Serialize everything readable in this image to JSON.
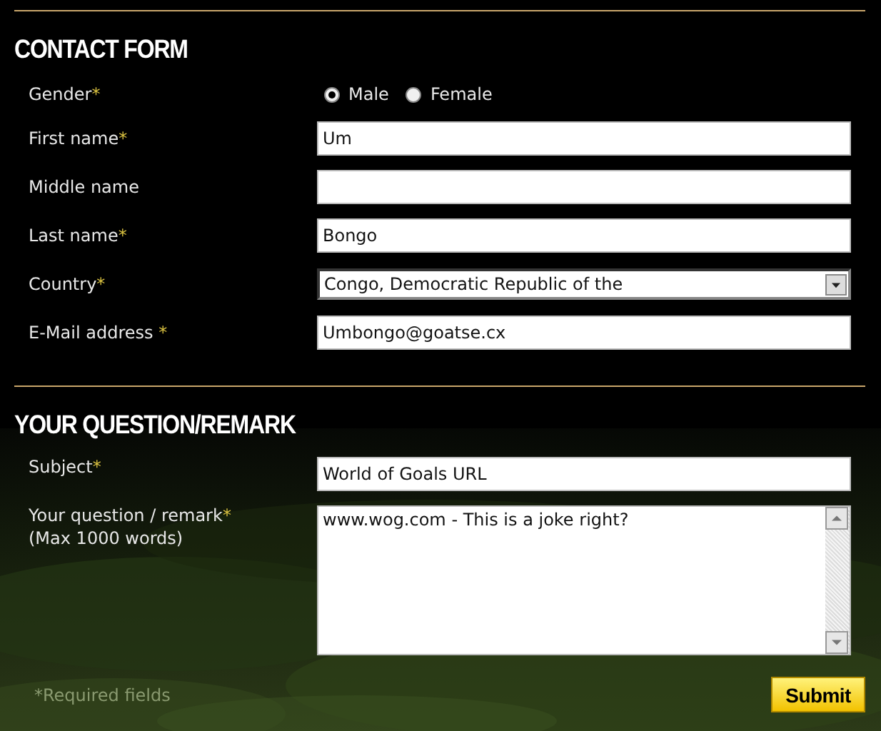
{
  "contact_form": {
    "heading": "CONTACT FORM",
    "gender": {
      "label": "Gender",
      "mark": "*",
      "options": [
        {
          "label": "Male",
          "selected": true
        },
        {
          "label": "Female",
          "selected": false
        }
      ]
    },
    "fields": [
      {
        "kind": "text",
        "label": "First name",
        "mark": "*",
        "value": "Um"
      },
      {
        "kind": "text",
        "label": "Middle name"
      },
      {
        "kind": "text",
        "label": "Last name",
        "mark": "*",
        "value": "Bongo"
      },
      {
        "kind": "select",
        "label": "Country",
        "mark": "*",
        "value": "Congo, Democratic Republic of the"
      },
      {
        "kind": "text",
        "label": "E-Mail address ",
        "mark": "*",
        "value": "Umbongo@goatse.cx"
      }
    ]
  },
  "question_section": {
    "heading": "YOUR QUESTION/REMARK",
    "subject": {
      "label": "Subject",
      "mark": "*",
      "value": "World of Goals URL"
    },
    "remark": {
      "label": "Your question / remark",
      "mark": "*",
      "hint": "(Max 1000 words)",
      "value": "www.wog.com - This is a joke right?"
    },
    "required_note": "*Required fields",
    "submit": "Submit"
  }
}
